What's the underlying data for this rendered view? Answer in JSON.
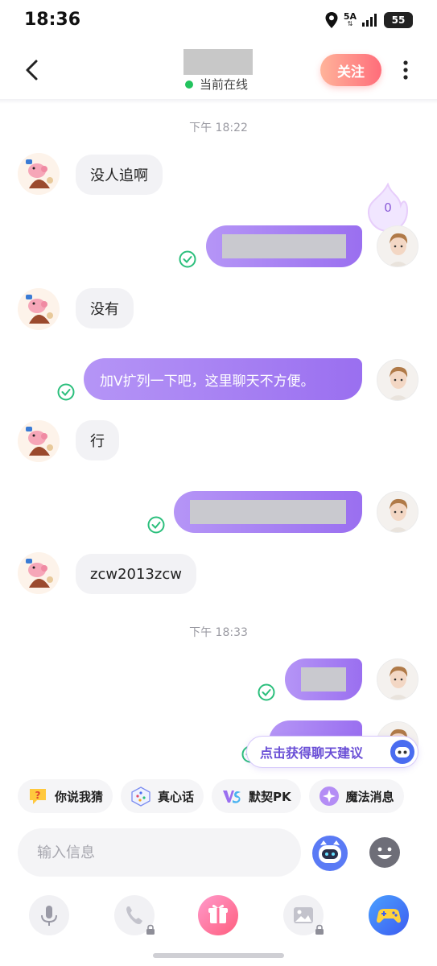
{
  "status_bar": {
    "time": "18:36",
    "network": "5A",
    "battery": "55"
  },
  "header": {
    "status_text": "当前在线",
    "follow_label": "关注"
  },
  "chat": {
    "timestamps": [
      "下午 18:22",
      "下午 18:33"
    ],
    "intimacy_count": "0",
    "messages": [
      {
        "side": "in",
        "text": "没人追啊"
      },
      {
        "side": "out",
        "text": ""
      },
      {
        "side": "in",
        "text": "没有"
      },
      {
        "side": "out",
        "text": "加V扩列一下吧，这里聊天不方便。"
      },
      {
        "side": "in",
        "text": "行"
      },
      {
        "side": "out",
        "text": ""
      },
      {
        "side": "in",
        "text": "zcw2013zcw"
      },
      {
        "side": "out",
        "text": ""
      },
      {
        "side": "out",
        "text": ""
      }
    ]
  },
  "suggestion": {
    "label": "点击获得聊天建议"
  },
  "quick_actions": [
    {
      "label": "你说我猜",
      "icon": "question-bubble-icon"
    },
    {
      "label": "真心话",
      "icon": "dice-icon"
    },
    {
      "label": "默契PK",
      "icon": "vs-icon"
    },
    {
      "label": "魔法消息",
      "icon": "magic-star-icon"
    }
  ],
  "input": {
    "placeholder": "输入信息"
  },
  "toolbar": [
    "microphone-icon",
    "phone-icon",
    "gift-icon",
    "image-icon",
    "gamepad-icon"
  ],
  "colors": {
    "accent_purple": "#9a6ff0",
    "online_green": "#22c35e",
    "follow_gradient": "#ff6d7a"
  }
}
